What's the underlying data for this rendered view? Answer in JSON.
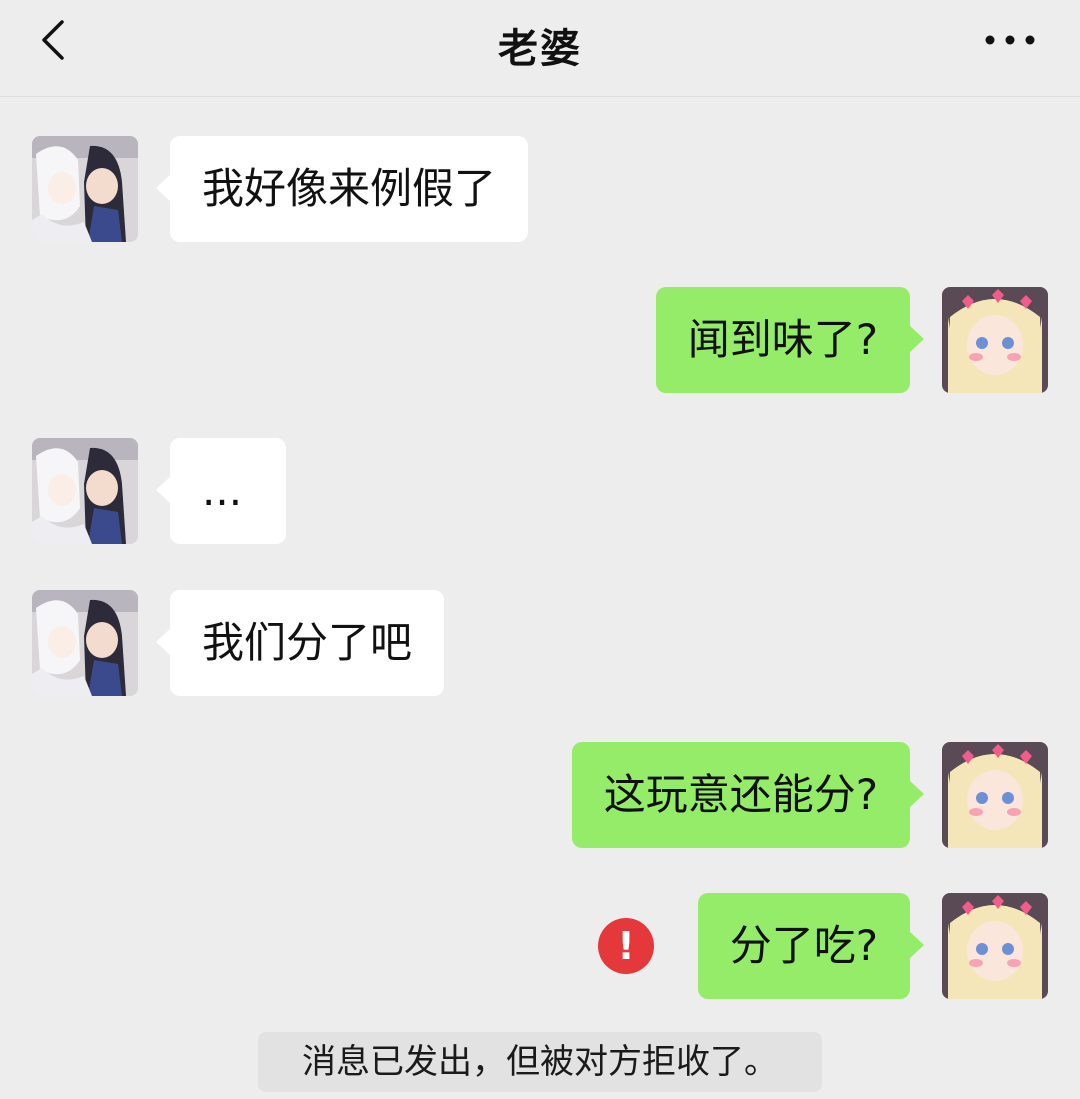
{
  "header": {
    "title": "老婆",
    "back_icon": "chevron-left-icon",
    "more_icon": "more-horizontal-icon"
  },
  "messages": [
    {
      "from": "them",
      "text": "我好像来例假了"
    },
    {
      "from": "me",
      "text": "闻到味了?"
    },
    {
      "from": "them",
      "text": "..."
    },
    {
      "from": "them",
      "text": "我们分了吧"
    },
    {
      "from": "me",
      "text": "这玩意还能分?"
    },
    {
      "from": "me",
      "text": "分了吃?",
      "failed": true,
      "error_mark": "!"
    }
  ],
  "system_note": "消息已发出，但被对方拒收了。",
  "colors": {
    "background": "#ededed",
    "incoming_bubble": "#ffffff",
    "outgoing_bubble": "#95ec69",
    "error": "#e5383b"
  }
}
